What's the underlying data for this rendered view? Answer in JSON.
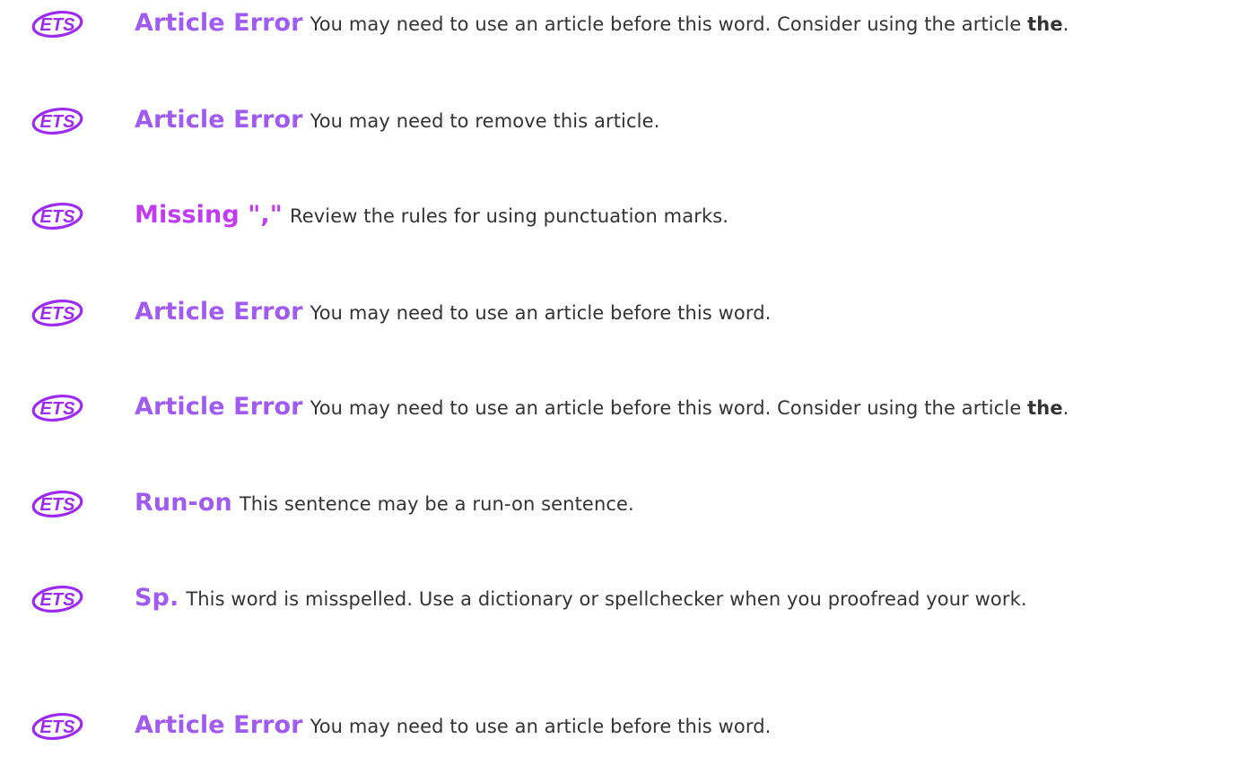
{
  "accent_colors": {
    "article": "#a05cf0",
    "punctuation": "#c03cf0",
    "logo": "#9b2cf0"
  },
  "logo": {
    "text": "ETS"
  },
  "items": [
    {
      "title": "Article Error",
      "message": "You may need to use an article before this word. Consider using the article",
      "emphasis": "the",
      "trailing": "."
    },
    {
      "title": "Article Error",
      "message": "You may need to remove this article.",
      "emphasis": "",
      "trailing": ""
    },
    {
      "title": "Missing \",\"",
      "message": "Review the rules for using punctuation marks.",
      "emphasis": "",
      "trailing": ""
    },
    {
      "title": "Article Error",
      "message": "You may need to use an article before this word.",
      "emphasis": "",
      "trailing": ""
    },
    {
      "title": "Article Error",
      "message": "You may need to use an article before this word. Consider using the article",
      "emphasis": "the",
      "trailing": "."
    },
    {
      "title": "Run-on",
      "message": "This sentence may be a run-on sentence.",
      "emphasis": "",
      "trailing": ""
    },
    {
      "title": "Sp.",
      "message": "This word is misspelled. Use a dictionary or spellchecker when you proofread your work.",
      "emphasis": "",
      "trailing": ""
    },
    {
      "title": "Article Error",
      "message": "You may need to use an article before this word.",
      "emphasis": "",
      "trailing": ""
    }
  ]
}
